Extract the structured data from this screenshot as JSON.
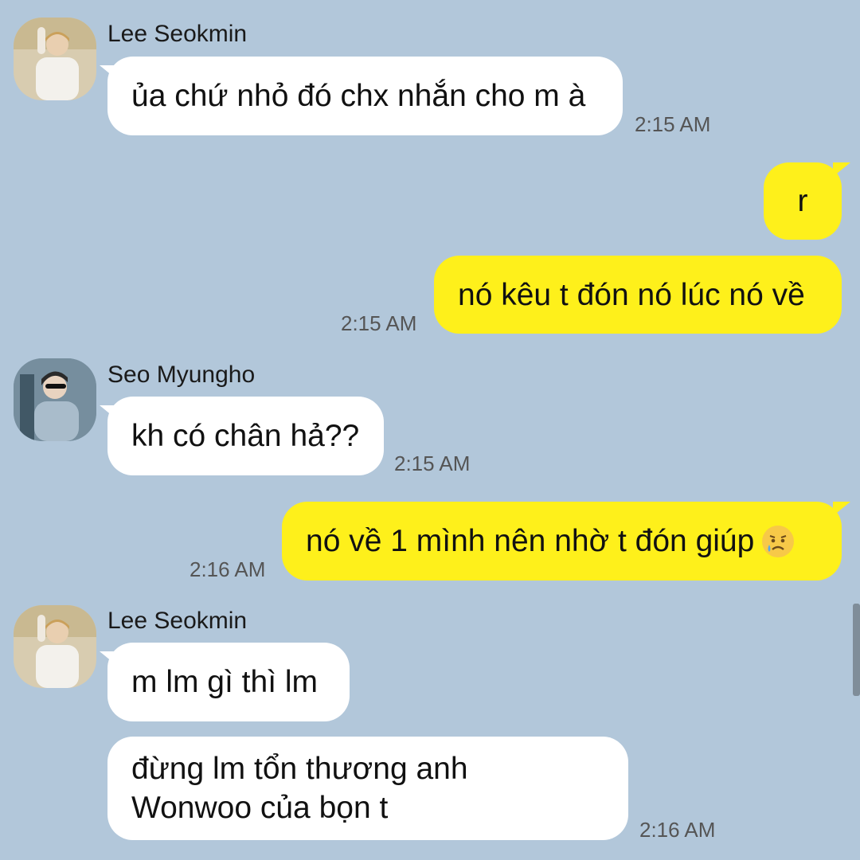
{
  "messages": [
    {
      "sender": "Lee Seokmin",
      "text": "ủa chứ nhỏ đó chx nhắn cho m à",
      "time": "2:15 AM"
    },
    {
      "text": "r"
    },
    {
      "text": "nó kêu t đón nó lúc nó về",
      "time": "2:15 AM"
    },
    {
      "sender": "Seo Myungho",
      "text": "kh có chân hả??",
      "time": "2:15 AM"
    },
    {
      "text": "nó về 1 mình nên nhờ t đón giúp",
      "emoji": "sad-relieved-face-icon",
      "time": "2:16 AM"
    },
    {
      "sender": "Lee Seokmin",
      "text": "m lm gì thì lm"
    },
    {
      "lines": [
        "đừng lm tổn thương anh",
        "Wonwoo của bọn t"
      ],
      "time": "2:16 AM"
    }
  ],
  "colors": {
    "background": "#b2c7da",
    "incoming_bubble": "#ffffff",
    "outgoing_bubble": "#fef01b",
    "timestamp": "#555555"
  }
}
